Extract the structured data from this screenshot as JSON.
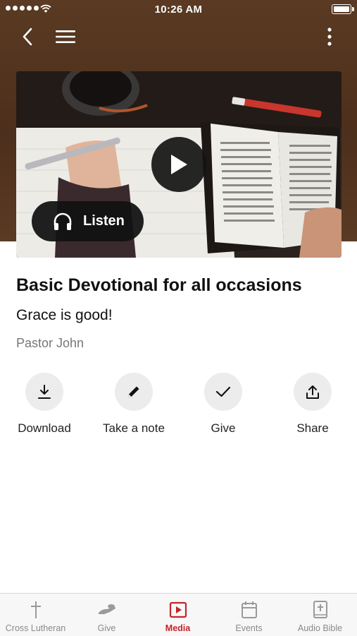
{
  "status_bar": {
    "time": "10:26 AM"
  },
  "nav": {
    "back_icon": "chevron-left-icon",
    "menu_icon": "hamburger-icon",
    "more_icon": "vertical-ellipsis-icon"
  },
  "media": {
    "play_icon": "play-icon",
    "listen_label": "Listen",
    "listen_icon": "headphones-icon"
  },
  "content": {
    "title": "Basic Devotional for all occasions",
    "subtitle": "Grace is good!",
    "author": "Pastor John"
  },
  "actions": [
    {
      "label": "Download",
      "icon": "download-icon"
    },
    {
      "label": "Take a note",
      "icon": "pencil-icon"
    },
    {
      "label": "Give",
      "icon": "checkmark-icon"
    },
    {
      "label": "Share",
      "icon": "share-icon"
    }
  ],
  "tabs": [
    {
      "label": "Cross Lutheran",
      "icon": "cross-icon",
      "active": false
    },
    {
      "label": "Give",
      "icon": "giving-hand-icon",
      "active": false
    },
    {
      "label": "Media",
      "icon": "media-play-icon",
      "active": true
    },
    {
      "label": "Events",
      "icon": "calendar-icon",
      "active": false
    },
    {
      "label": "Audio Bible",
      "icon": "bible-icon",
      "active": false
    }
  ],
  "colors": {
    "header_brown": "#4c2f1c",
    "accent_red": "#c4242a",
    "tab_inactive": "#8a8a8a"
  }
}
